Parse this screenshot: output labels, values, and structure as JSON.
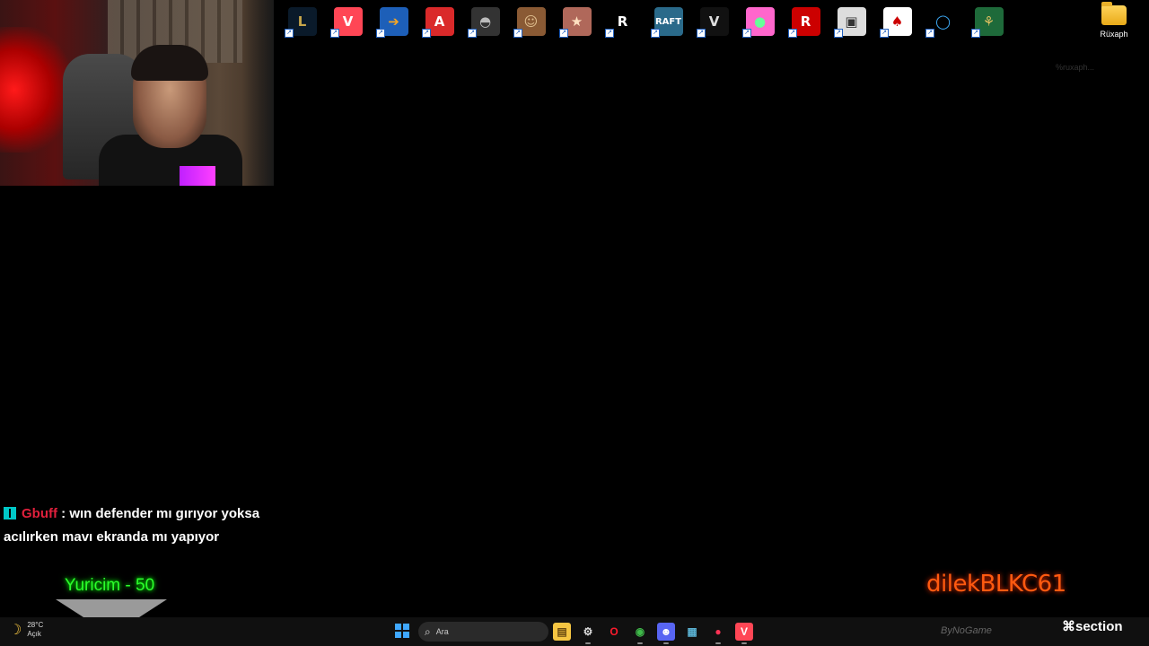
{
  "desktop": {
    "icons": [
      {
        "name": "league-of-legends-icon",
        "glyph": "L",
        "bg": "#0a1a2a",
        "fg": "#c8a64a"
      },
      {
        "name": "valorant-icon",
        "glyph": "V",
        "bg": "#ff4655",
        "fg": "#ffffff"
      },
      {
        "name": "counter-strike-icon",
        "glyph": "➔",
        "bg": "#1d5fb8",
        "fg": "#f5a623"
      },
      {
        "name": "apex-legends-icon",
        "glyph": "A",
        "bg": "#da292a",
        "fg": "#ffffff"
      },
      {
        "name": "pubg-icon",
        "glyph": "◓",
        "bg": "#333333",
        "fg": "#bbbbbb"
      },
      {
        "name": "hitman-portrait-icon",
        "glyph": "☺",
        "bg": "#8a5a34",
        "fg": "#e0c090"
      },
      {
        "name": "battlefield-icon",
        "glyph": "★",
        "bg": "#b0685a",
        "fg": "#ffe0c0"
      },
      {
        "name": "riot-client-icon",
        "glyph": "R",
        "bg": "#000000",
        "fg": "#ffffff"
      },
      {
        "name": "raft-icon",
        "glyph": "RAFT",
        "bg": "#2a6a8a",
        "fg": "#ffffff"
      },
      {
        "name": "gta-v-icon",
        "glyph": "V",
        "bg": "#111111",
        "fg": "#dddddd"
      },
      {
        "name": "fall-guys-icon",
        "glyph": "●",
        "bg": "#ff66cc",
        "fg": "#66ff99"
      },
      {
        "name": "rockstar-launcher-icon",
        "glyph": "R",
        "bg": "#cc0000",
        "fg": "#ffffff"
      },
      {
        "name": "game-overlay-icon",
        "glyph": "▣",
        "bg": "#dddddd",
        "fg": "#333333"
      },
      {
        "name": "solitaire-icon",
        "glyph": "♠",
        "bg": "#ffffff",
        "fg": "#cc0000"
      },
      {
        "name": "obs-ring-icon",
        "glyph": "◯",
        "bg": "#000000",
        "fg": "#3fb0ff"
      },
      {
        "name": "dragon-game-icon",
        "glyph": "⚘",
        "bg": "#1e6a3a",
        "fg": "#e0c060"
      }
    ],
    "folder_label": "Rüxaph",
    "ghost_text": "%ruxaph..."
  },
  "chat": {
    "username": "Gbuff",
    "separator": " : ",
    "message_line1": "wın defender mı gırıyor yoksa",
    "message_line2": "acılırken mavı ekranda mı yapıyor"
  },
  "goal": {
    "text": "Yuricim - 50"
  },
  "watermark": {
    "channel": "dilekBLKC61",
    "brand": "⌘section"
  },
  "taskbar": {
    "weather_temp": "28°C",
    "weather_desc": "Açık",
    "search_placeholder": "Ara",
    "apps": [
      {
        "name": "file-explorer-icon",
        "glyph": "▤",
        "bg": "#f5c542",
        "fg": "#6a4a10",
        "active": false
      },
      {
        "name": "steam-icon",
        "glyph": "⚙",
        "bg": "transparent",
        "fg": "#dddddd",
        "active": true
      },
      {
        "name": "opera-icon",
        "glyph": "O",
        "bg": "transparent",
        "fg": "#ff1b2d",
        "active": false
      },
      {
        "name": "chrome-icon",
        "glyph": "◉",
        "bg": "transparent",
        "fg": "#3fba4a",
        "active": true
      },
      {
        "name": "discord-icon",
        "glyph": "☻",
        "bg": "#5865f2",
        "fg": "#ffffff",
        "active": true
      },
      {
        "name": "window-icon",
        "glyph": "▦",
        "bg": "transparent",
        "fg": "#5ab0d0",
        "active": false
      },
      {
        "name": "red-app-icon",
        "glyph": "●",
        "bg": "transparent",
        "fg": "#ff3355",
        "active": true
      },
      {
        "name": "valorant-taskbar-icon",
        "glyph": "V",
        "bg": "#ff4655",
        "fg": "#ffffff",
        "active": true
      }
    ],
    "tray_text": "ByNoGame"
  }
}
